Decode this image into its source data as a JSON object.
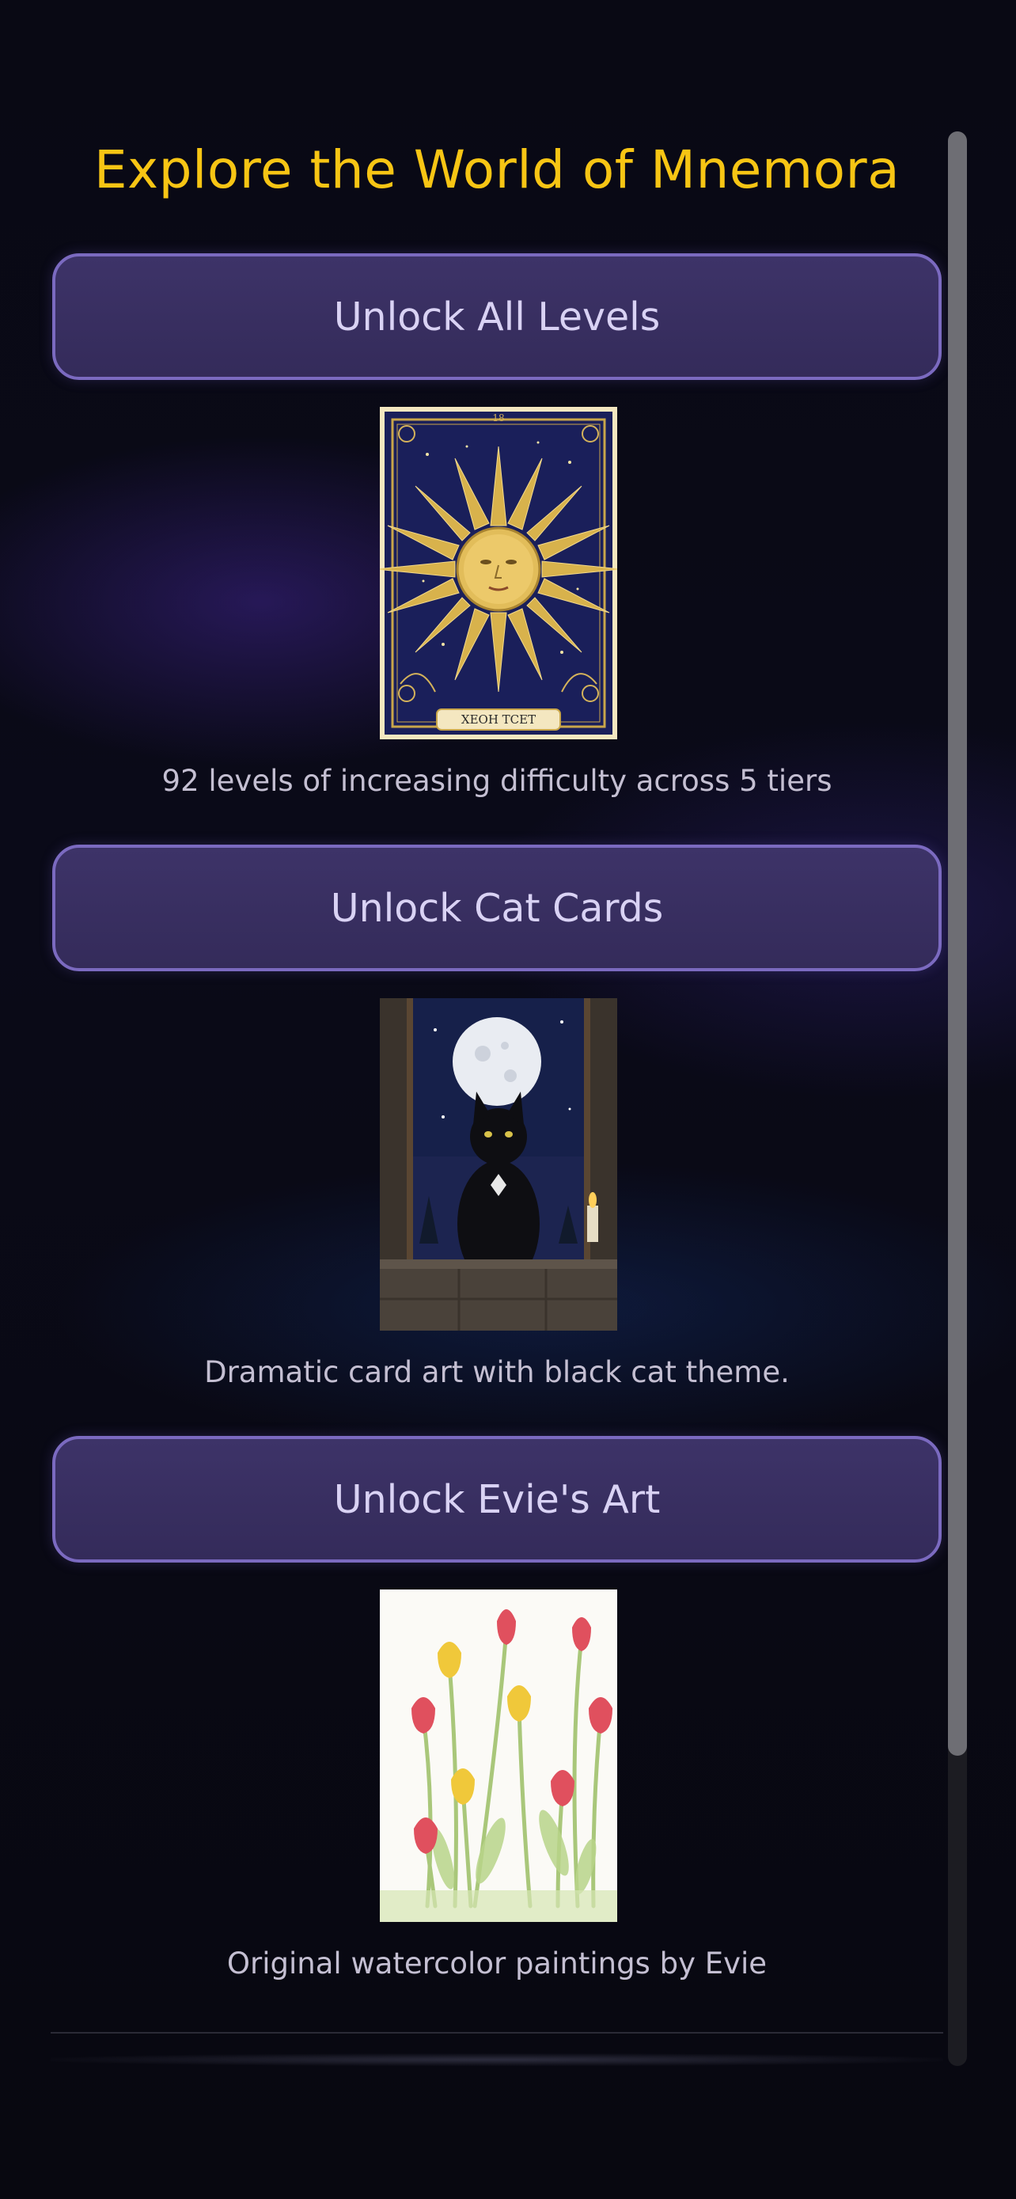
{
  "page": {
    "title": "Explore the World of Mnemora"
  },
  "sections": [
    {
      "button_label": "Unlock All Levels",
      "image": "sun-tarot-card",
      "card_text": "XEOH TCET",
      "card_number": "18",
      "description": "92 levels of increasing difficulty across 5 tiers"
    },
    {
      "button_label": "Unlock Cat Cards",
      "image": "black-cat-moon-card",
      "description": "Dramatic card art with black cat theme."
    },
    {
      "button_label": "Unlock Evie's Art",
      "image": "watercolor-tulips",
      "description": "Original watercolor paintings by Evie"
    }
  ],
  "colors": {
    "title": "#f7c514",
    "button_bg": "#3d3368",
    "button_border": "#7b6ac0",
    "button_text": "#d9d2f4",
    "description_text": "#c4bfd2",
    "background": "#07070f"
  }
}
